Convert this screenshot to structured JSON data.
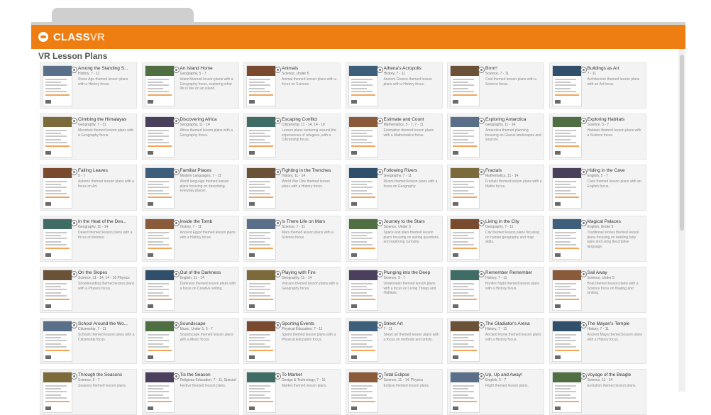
{
  "app": {
    "brand": "CLASS",
    "brand_suffix": "VR",
    "section_title": "VR Lesson Plans"
  },
  "thumb_colors": [
    "#5a6f8a",
    "#4f6f43",
    "#7a4a2e",
    "#3d5f7c",
    "#6b5236",
    "#2f4f6a",
    "#7d6a3a",
    "#4a3f5c",
    "#3f6c64",
    "#8a5a3a"
  ],
  "cards": [
    {
      "title": "Among the Standing S...",
      "sub": "History, 7 - 11",
      "desc": "Stone Age themed lesson plans with a History focus."
    },
    {
      "title": "An Island Home",
      "sub": "Geography, 5 - 7",
      "desc": "Island themed lesson plans with a Geography focus, exploring what life is like on an island."
    },
    {
      "title": "Animals",
      "sub": "Science, Under 5",
      "desc": "Animal themed lesson plans with a focus on Science."
    },
    {
      "title": "Athena's Acropolis",
      "sub": "History, 7 - 11",
      "desc": "Ancient Greece themed lesson plans with a History focus."
    },
    {
      "title": "Brrrrr!",
      "sub": "Science, 7 - 11",
      "desc": "Cold themed lesson plans with a Science focus."
    },
    {
      "title": "Buildings as Art",
      "sub": "7 - 11",
      "desc": "Architecture themed lesson plans with an Art focus."
    },
    {
      "title": "Climbing the Himalayas",
      "sub": "Geography, 7 - 11",
      "desc": "Mountain themed lesson plans with a Geography focus."
    },
    {
      "title": "Discovering Africa",
      "sub": "Geography, 11 - 14",
      "desc": "Africa themed lesson plans with a Geography focus."
    },
    {
      "title": "Escaping Conflict",
      "sub": "Citizenship, 11 - 14, 14 - 18",
      "desc": "Lesson plans centering around the experiences of refugees, with a Citizenship focus."
    },
    {
      "title": "Estimate and Count",
      "sub": "Mathematics, 5 - 7, 7 - 11",
      "desc": "Estimation themed lesson plans with a Mathematics focus."
    },
    {
      "title": "Exploring Antarctica",
      "sub": "Geography, 11 - 14",
      "desc": "Antarctica themed planning focusing on Glacial landscapes and sources."
    },
    {
      "title": "Exploring Habitats",
      "sub": "Science, 5 - 7",
      "desc": "Habitats themed lesson plans with a Science focus."
    },
    {
      "title": "Falling Leaves",
      "sub": "5 - 7",
      "desc": "Autumn themed lesson plans with a focus on Art."
    },
    {
      "title": "Familiar Places",
      "sub": "Modern Languages, 7 - 11",
      "desc": "World language themed lesson plans focusing on describing everyday places."
    },
    {
      "title": "Fighting in the Trenches",
      "sub": "History, 11 - 14",
      "desc": "World War One themed lesson plans with a History focus."
    },
    {
      "title": "Following Rivers",
      "sub": "Geography, 7 - 11",
      "desc": "Rivers themed lesson plans with a focus on Geography."
    },
    {
      "title": "Fractals",
      "sub": "Mathematics, 11 - 14",
      "desc": "Fractals themed lesson plans with a Maths focus."
    },
    {
      "title": "Hiding in the Cave",
      "sub": "English, 5 - 7",
      "desc": "Cave themed lesson plans with an English focus."
    },
    {
      "title": "In the Heat of the Des...",
      "sub": "Geography, 11 - 14",
      "desc": "Desert themed lesson plans with a focus on biomes."
    },
    {
      "title": "Inside the Tomb",
      "sub": "History, 7 - 11",
      "desc": "Ancient Egypt themed lesson plans with a History focus."
    },
    {
      "title": "Is There Life on Mars",
      "sub": "Science, 7 - 11",
      "desc": "Mars themed lesson plans with a Science focus."
    },
    {
      "title": "Journey to the Stars",
      "sub": "Science, Under 5",
      "desc": "Space and stars themed lesson plans focusing on asking questions and exploring curiosity."
    },
    {
      "title": "Living in the City",
      "sub": "Geography, 7 - 11",
      "desc": "City themed lesson plans focusing on human geography and map skills."
    },
    {
      "title": "Magical Palaces",
      "sub": "English, Under 5",
      "desc": "Traditional stories themed lesson plans focusing on retelling fairy tales and using descriptive language."
    },
    {
      "title": "On the Slopes",
      "sub": "Science, 11 - 14, 14 - 16 Physics",
      "desc": "Snowboarding themed lesson plans with a Physics focus."
    },
    {
      "title": "Out of the Darkness",
      "sub": "English, 11 - 14",
      "desc": "Darkness themed lesson plans with a focus on Creative writing."
    },
    {
      "title": "Playing with Fire",
      "sub": "Geography, 11 - 14",
      "desc": "Volcano themed lesson plans with a Geography focus."
    },
    {
      "title": "Plunging into the Deep",
      "sub": "Science, 5 - 7",
      "desc": "Underwater themed lesson plans with a focus on Living Things and Habitats."
    },
    {
      "title": "Remember Remember",
      "sub": "History, 7 - 11",
      "desc": "Bonfire Night themed lesson plans with a History focus."
    },
    {
      "title": "Sail Away",
      "sub": "Science, Under 5",
      "desc": "Boat themed lesson plans with a Science focus on floating and sinking."
    },
    {
      "title": "School Around the Wo...",
      "sub": "Citizenship, 7 - 11",
      "desc": "Schools themed lesson plans with a Citizenship focus."
    },
    {
      "title": "Soundscape",
      "sub": "Music, Under 5, 5 - 7",
      "desc": "Soundscape themed lesson plans with a Music focus."
    },
    {
      "title": "Sporting Events",
      "sub": "Physical Education, 7 - 11",
      "desc": "Sports themed lesson plans with a Physical Education focus."
    },
    {
      "title": "Street Art",
      "sub": "7 - 11",
      "desc": "Street art themed lesson plans with a focus on methods and artists."
    },
    {
      "title": "The Gladiator's Arena",
      "sub": "History, 7 - 11",
      "desc": "Ancient Rome themed lesson plans with a History focus."
    },
    {
      "title": "The Mayan's Temple",
      "sub": "History, 7 - 11",
      "desc": "Ancient Maya themed lesson plans with a History focus."
    },
    {
      "title": "Through the Seasons",
      "sub": "Science, 5 - 7",
      "desc": "Seasons themed lesson plans."
    },
    {
      "title": "Tis the Season",
      "sub": "Religious Education, 7 - 11, Special Events",
      "desc": "Festive themed lesson plans."
    },
    {
      "title": "To Market",
      "sub": "Design & Technology, 7 - 11",
      "desc": "Market themed lesson plans."
    },
    {
      "title": "Total Eclipse",
      "sub": "Science, 11 - 14, Physics",
      "desc": "Eclipse themed lesson plans."
    },
    {
      "title": "Up, Up and Away!",
      "sub": "English, 5 - 7",
      "desc": "Flight themed lesson plans."
    },
    {
      "title": "Voyage of the Beagle",
      "sub": "Science, 11 - 14",
      "desc": "Evolution themed lesson plans."
    }
  ]
}
